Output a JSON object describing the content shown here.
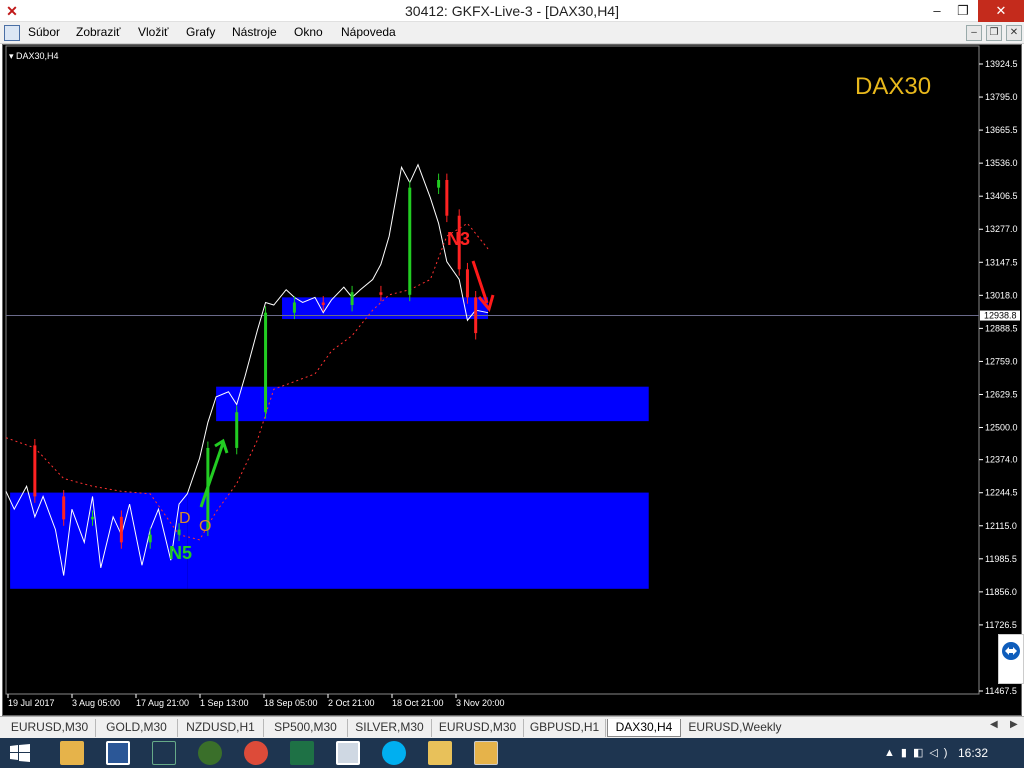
{
  "window": {
    "title": "30412: GKFX-Live-3 - [DAX30,H4]",
    "minimize_glyph": "–",
    "restore_glyph": "❐",
    "close_glyph": "✕"
  },
  "menu": {
    "items": [
      "Súbor",
      "Zobraziť",
      "Vložiť",
      "Grafy",
      "Nástroje",
      "Okno",
      "Nápoveda"
    ],
    "mdi_buttons": [
      "–",
      "❐",
      "✕"
    ]
  },
  "chart": {
    "symbol_label": "DAX30,H4",
    "big_label": "DAX30",
    "current_price_label": "12938.8",
    "annotations": {
      "n3": "N3",
      "n5": "N5",
      "d": "D",
      "o": "O"
    }
  },
  "colors": {
    "background": "#000000",
    "zone": "#0000ff",
    "price_white": "#ffffff",
    "bull": "#22cc22",
    "bear": "#ff2222",
    "arrow_up": "#22cc22",
    "arrow_down": "#ff1a1a",
    "label_gold": "#e8b81c",
    "dotted_red": "#ff3030",
    "grid_line": "#6a6a8a"
  },
  "chart_data": {
    "type": "line",
    "title": "DAX30",
    "instrument": "DAX30,H4",
    "xlabel": "",
    "ylabel": "",
    "ylim": [
      11467.5,
      14000
    ],
    "y_ticks": [
      13924.5,
      13795.0,
      13665.5,
      13536.0,
      13406.5,
      13277.0,
      13147.5,
      13018.0,
      12888.5,
      12759.0,
      12629.5,
      12500.0,
      12374.0,
      12244.5,
      12115.0,
      11985.5,
      11856.0,
      11726.5,
      11467.5
    ],
    "y_tick_labels": [
      "13924.5",
      "13795.0",
      "13665.5",
      "13536.0",
      "13406.5",
      "13277.0",
      "13147.5",
      "13018.0",
      "12888.5",
      "12759.0",
      "12629.5",
      "12500.0",
      "12374.0",
      "12244.5",
      "12115.0",
      "11985.5",
      "11856.0",
      "11726.5",
      "11467.5"
    ],
    "x_tick_labels": [
      "19 Jul 2017",
      "3 Aug 05:00",
      "17 Aug 21:00",
      "1 Sep 13:00",
      "18 Sep 05:00",
      "2 Oct 21:00",
      "18 Oct 21:00",
      "3 Nov 20:00"
    ],
    "current_price": 12938.8,
    "zones": [
      {
        "x_start": "20 Jul",
        "x_end": "1 Sep",
        "y_low": 11868,
        "y_high": 12245
      },
      {
        "x_start": "1 Sep",
        "x_end": "22 Dec",
        "y_low": 12245,
        "y_high": 11868
      },
      {
        "x_start": "8 Sep",
        "x_end": "22 Dec",
        "y_low": 12525,
        "y_high": 12660
      },
      {
        "x_start": "24 Sep",
        "x_end": "13 Nov",
        "y_low": 12925,
        "y_high": 13010
      }
    ],
    "series": [
      {
        "name": "",
        "style": "solid-white",
        "x": [
          "19 Jul",
          "21 Jul",
          "24 Jul",
          "26 Jul",
          "28 Jul",
          "31 Jul",
          "2 Aug",
          "4 Aug",
          "7 Aug",
          "9 Aug",
          "11 Aug",
          "14 Aug",
          "16 Aug",
          "18 Aug",
          "21 Aug",
          "23 Aug",
          "25 Aug",
          "28 Aug",
          "30 Aug",
          "1 Sep",
          "4 Sep",
          "6 Sep",
          "8 Sep",
          "11 Sep",
          "13 Sep",
          "15 Sep",
          "18 Sep",
          "20 Sep",
          "22 Sep",
          "25 Sep",
          "27 Sep",
          "29 Sep",
          "2 Oct",
          "4 Oct",
          "6 Oct",
          "9 Oct",
          "11 Oct",
          "13 Oct",
          "16 Oct",
          "18 Oct",
          "20 Oct",
          "23 Oct",
          "25 Oct",
          "27 Oct",
          "30 Oct",
          "1 Nov",
          "3 Nov",
          "6 Nov",
          "8 Nov",
          "10 Nov",
          "13 Nov"
        ],
        "values": [
          12250,
          12180,
          12270,
          12150,
          12230,
          12100,
          11920,
          12180,
          12050,
          12230,
          11950,
          12150,
          12080,
          12200,
          11960,
          12100,
          12180,
          11980,
          12200,
          12240,
          12380,
          12520,
          12620,
          12640,
          12590,
          12700,
          12880,
          12990,
          12980,
          13040,
          13010,
          12990,
          13010,
          12950,
          13000,
          13050,
          13010,
          13040,
          13080,
          13140,
          13250,
          13520,
          13460,
          13530,
          13400,
          13300,
          13150,
          13080,
          12920,
          12960,
          12950
        ]
      },
      {
        "name": "",
        "style": "dotted-red",
        "x": [
          "19 Jul",
          "26 Jul",
          "2 Aug",
          "9 Aug",
          "16 Aug",
          "23 Aug",
          "30 Aug",
          "4 Sep",
          "8 Sep",
          "13 Sep",
          "18 Sep",
          "22 Sep",
          "27 Sep",
          "2 Oct",
          "6 Oct",
          "11 Oct",
          "16 Oct",
          "20 Oct",
          "25 Oct",
          "30 Oct",
          "3 Nov",
          "8 Nov",
          "13 Nov"
        ],
        "values": [
          12460,
          12420,
          12300,
          12270,
          12250,
          12240,
          12080,
          12060,
          12170,
          12280,
          12450,
          12650,
          12680,
          12710,
          12800,
          12860,
          12960,
          13020,
          13040,
          13080,
          13250,
          13300,
          13200
        ]
      },
      {
        "name": "",
        "style": "candles",
        "x": [
          "19 Jul",
          "26 Jul",
          "2 Aug",
          "9 Aug",
          "16 Aug",
          "23 Aug",
          "30 Aug",
          "6 Sep",
          "13 Sep",
          "20 Sep",
          "27 Sep",
          "4 Oct",
          "11 Oct",
          "18 Oct",
          "25 Oct",
          "1 Nov",
          "3 Nov",
          "6 Nov",
          "8 Nov",
          "10 Nov"
        ],
        "values": [
          12430,
          12230,
          12140,
          12150,
          12050,
          12080,
          12100,
          12420,
          12560,
          12950,
          12990,
          12980,
          13030,
          13020,
          13440,
          13470,
          13330,
          13120,
          13010,
          12870
        ]
      }
    ]
  }
}
